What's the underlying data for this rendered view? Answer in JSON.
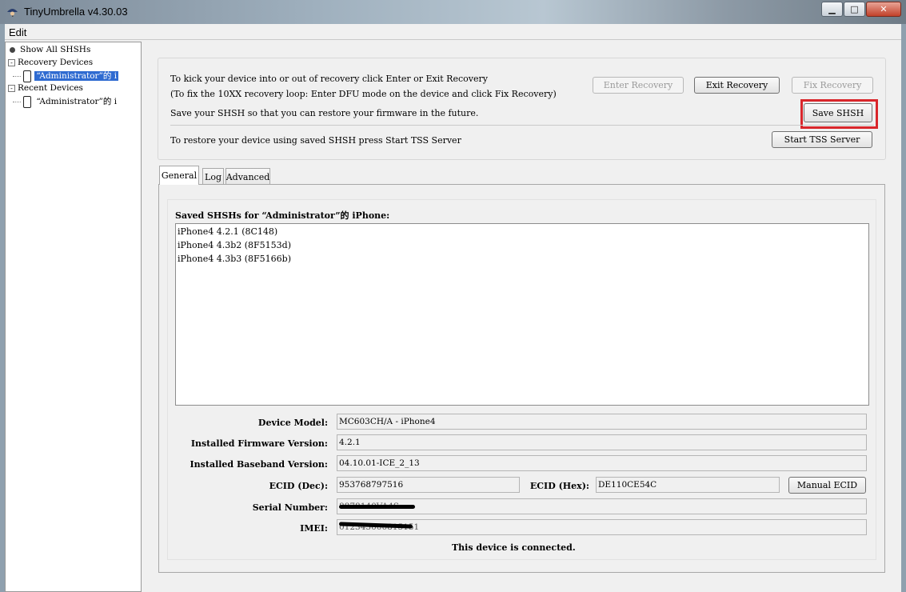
{
  "window": {
    "title": "TinyUmbrella v4.30.03",
    "minimize": "▁",
    "maximize": "□",
    "close": "✕"
  },
  "menu": {
    "edit": "Edit"
  },
  "sidebar": {
    "show_all": "Show All SHSHs",
    "recovery_devices": "Recovery Devices",
    "recovery_item": "“Administrator”的 i",
    "recent_devices": "Recent Devices",
    "recent_item": "“Administrator”的 i"
  },
  "recovery": {
    "line1": "To kick your device into or out of recovery click Enter or Exit Recovery",
    "line2": "(To fix the 10XX recovery loop: Enter DFU mode on the device and click Fix Recovery)",
    "enter": "Enter Recovery",
    "exit": "Exit Recovery",
    "fix": "Fix Recovery",
    "save_text": "Save your SHSH so that you can restore your firmware in the future.",
    "save": "Save SHSH",
    "restore_text": "To restore your device using saved SHSH press Start TSS Server",
    "tss": "Start TSS Server"
  },
  "tabs": {
    "general": "General",
    "log": "Log",
    "advanced": "Advanced"
  },
  "general": {
    "saved_title": "Saved SHSHs for “Administrator”的 iPhone:",
    "shsh_list": [
      "iPhone4 4.2.1 (8C148)",
      "iPhone4 4.3b2 (8F5153d)",
      "iPhone4 4.3b3 (8F5166b)"
    ],
    "device_model_label": "Device Model:",
    "device_model": "MC603CH/A - iPhone4",
    "firmware_label": "Installed Firmware Version:",
    "firmware": "4.2.1",
    "baseband_label": "Installed Baseband Version:",
    "baseband": "04.10.01-ICE_2_13",
    "ecid_dec_label": "ECID (Dec):",
    "ecid_dec": "953768797516",
    "ecid_hex_label": "ECID (Hex):",
    "ecid_hex": "DE110CE54C",
    "manual_ecid": "Manual ECID",
    "serial_label": "Serial Number:",
    "serial": "8878140VA4S",
    "imei_label": "IMEI:",
    "imei": "012345000815151",
    "status": "This device is connected."
  },
  "colors": {
    "highlight": "#d9262b",
    "selection": "#2f6bd1"
  }
}
